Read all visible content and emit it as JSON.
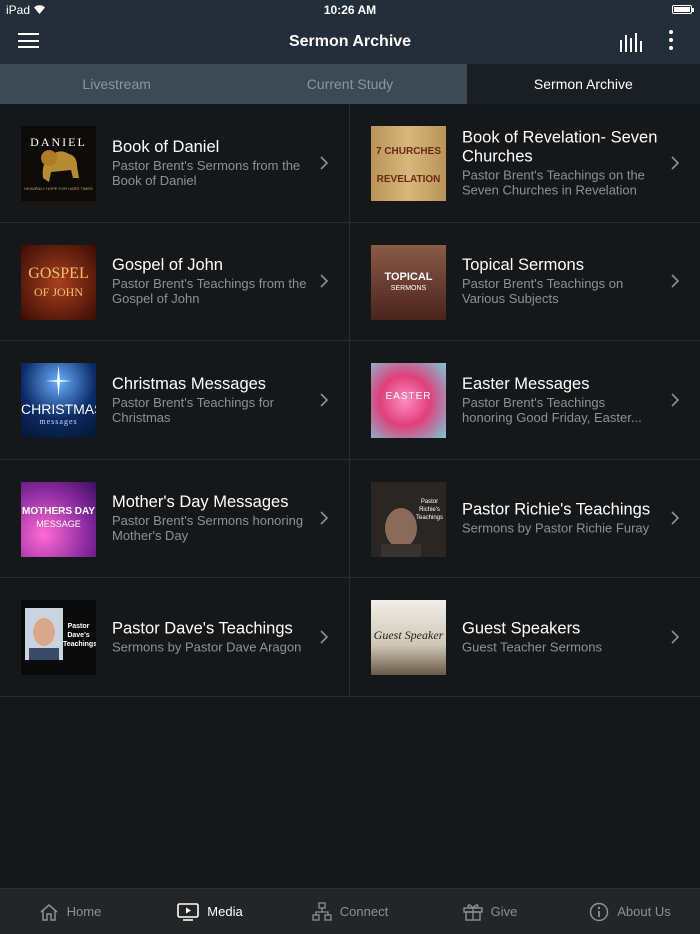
{
  "status": {
    "device": "iPad",
    "time": "10:26 AM",
    "battery_level": 1.0
  },
  "navbar": {
    "title": "Sermon Archive"
  },
  "tabs": [
    {
      "label": "Livestream",
      "active": false
    },
    {
      "label": "Current Study",
      "active": false
    },
    {
      "label": "Sermon Archive",
      "active": true
    }
  ],
  "items": [
    {
      "title": "Book of Daniel",
      "subtitle": "Pastor Brent's Sermons from the Book of Daniel",
      "thumb_text": "DANIEL",
      "thumb_sub": "HEAVENLY HOPE FOR HARD TIMES",
      "thumb_color": "#0c0b08"
    },
    {
      "title": "Book of Revelation- Seven Churches",
      "subtitle": "Pastor Brent's Teachings on the Seven Churches in Revelation",
      "thumb_text": "7 CHURCHES",
      "thumb_sub": "REVELATION",
      "thumb_color": "#c9a56a"
    },
    {
      "title": "Gospel of John",
      "subtitle": "Pastor Brent's Teachings from the Gospel of John",
      "thumb_text": "GOSPEL",
      "thumb_sub": "OF JOHN",
      "thumb_color": "#5a1a10"
    },
    {
      "title": "Topical Sermons",
      "subtitle": "Pastor Brent's Teachings on Various Subjects",
      "thumb_text": "TOPICAL",
      "thumb_sub": "SERMONS",
      "thumb_color": "#6b3a2e"
    },
    {
      "title": "Christmas Messages",
      "subtitle": "Pastor Brent's Teachings for Christmas",
      "thumb_text": "CHRISTMAS",
      "thumb_sub": "messages",
      "thumb_color": "#0c2a5c"
    },
    {
      "title": "Easter Messages",
      "subtitle": "Pastor Brent's Teachings honoring Good Friday, Easter...",
      "thumb_text": "EASTER",
      "thumb_sub": "",
      "thumb_color": "#e0408a"
    },
    {
      "title": "Mother's Day Messages",
      "subtitle": "Pastor Brent's Sermons honoring Mother's Day",
      "thumb_text": "MOTHERS DAY",
      "thumb_sub": "MESSAGE",
      "thumb_color": "#7a2a8a"
    },
    {
      "title": "Pastor Richie's Teachings",
      "subtitle": "Sermons by Pastor Richie Furay",
      "thumb_text": "Pastor Richie's Teachings",
      "thumb_sub": "",
      "thumb_color": "#2a2624"
    },
    {
      "title": "Pastor Dave's Teachings",
      "subtitle": "Sermons by Pastor Dave Aragon",
      "thumb_text": "Pastor Dave's Teachings",
      "thumb_sub": "",
      "thumb_color": "#0a0a0a"
    },
    {
      "title": "Guest Speakers",
      "subtitle": "Guest Teacher Sermons",
      "thumb_text": "Guest Speaker",
      "thumb_sub": "",
      "thumb_color": "#e8e4dc"
    }
  ],
  "tabbar": [
    {
      "label": "Home",
      "icon": "home-icon",
      "active": false
    },
    {
      "label": "Media",
      "icon": "media-icon",
      "active": true
    },
    {
      "label": "Connect",
      "icon": "connect-icon",
      "active": false
    },
    {
      "label": "Give",
      "icon": "gift-icon",
      "active": false
    },
    {
      "label": "About Us",
      "icon": "info-icon",
      "active": false
    }
  ]
}
